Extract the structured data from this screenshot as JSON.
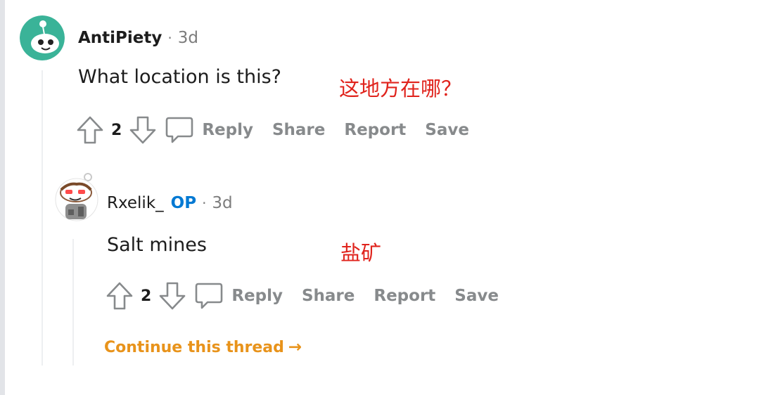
{
  "comments": [
    {
      "author": "AntiPiety",
      "separator": "·",
      "time": "3d",
      "body": "What location is this?",
      "annotation": "这地方在哪？",
      "score": "2",
      "actions": {
        "reply": "Reply",
        "share": "Share",
        "report": "Report",
        "save": "Save"
      }
    },
    {
      "author": "Rxelik_",
      "badge": "OP",
      "separator": "·",
      "time": "3d",
      "body": "Salt mines",
      "annotation": "盐矿",
      "score": "2",
      "actions": {
        "reply": "Reply",
        "share": "Share",
        "report": "Report",
        "save": "Save"
      }
    }
  ],
  "continue_thread": {
    "label": "Continue this thread",
    "arrow": "→"
  },
  "icons": [
    "snoo-avatar-icon",
    "upvote-arrow-icon",
    "downvote-arrow-icon",
    "comment-bubble-icon",
    "arrow-right-icon"
  ],
  "colors": {
    "op_badge": "#0079d3",
    "continue_link": "#e8931b",
    "annotation": "#e0231c",
    "action_text": "#878a8c",
    "meta_muted": "#7c7c7c",
    "avatar_green": "#3ab398"
  }
}
